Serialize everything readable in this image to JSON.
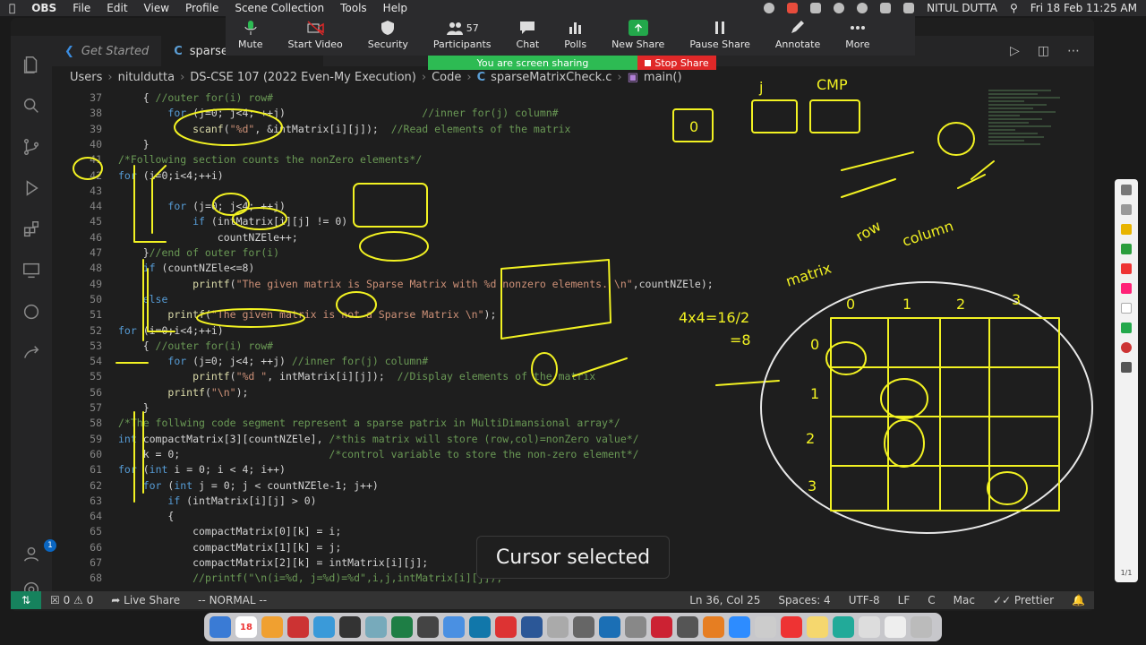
{
  "menubar": {
    "app": "OBS",
    "items": [
      "File",
      "Edit",
      "View",
      "Profile",
      "Scene Collection",
      "Tools",
      "Help"
    ],
    "user": "NITUL DUTTA",
    "datetime": "Fri 18 Feb  11:25 AM"
  },
  "zoom": {
    "buttons": [
      {
        "label": "Mute",
        "icon": "microphone-icon"
      },
      {
        "label": "Start Video",
        "icon": "video-off-icon"
      },
      {
        "label": "Security",
        "icon": "shield-icon"
      },
      {
        "label": "Participants",
        "icon": "participants-icon",
        "count": "57"
      },
      {
        "label": "Chat",
        "icon": "chat-icon"
      },
      {
        "label": "Polls",
        "icon": "polls-icon"
      },
      {
        "label": "New Share",
        "icon": "share-icon"
      },
      {
        "label": "Pause Share",
        "icon": "pause-icon"
      },
      {
        "label": "Annotate",
        "icon": "pencil-icon"
      },
      {
        "label": "More",
        "icon": "more-icon"
      }
    ],
    "sharing_msg": "You are screen sharing",
    "stop_share": "Stop Share"
  },
  "tabs": [
    {
      "label": "Get Started"
    },
    {
      "label": "sparseMatrixCheck.c"
    }
  ],
  "breadcrumb": [
    "Users",
    "nituldutta",
    "DS-CSE 107 (2022 Even-My Execution)",
    "Code",
    "sparseMatrixCheck.c",
    "main()"
  ],
  "code_lines": [
    {
      "n": "37",
      "text": "    { //outer for(i) row#"
    },
    {
      "n": "38",
      "text": "        for (j=0; j<4; ++j)                      //inner for(j) column#"
    },
    {
      "n": "39",
      "text": "            scanf(\"%d\", &intMatrix[i][j]);  //Read elements of the matrix"
    },
    {
      "n": "40",
      "text": "    }"
    },
    {
      "n": "41",
      "text": "/*Following section counts the nonZero elements*/"
    },
    {
      "n": "42",
      "text": "for (i=0;i<4;++i)"
    },
    {
      "n": "43",
      "text": ""
    },
    {
      "n": "44",
      "text": "        for (j=0; j<4; ++j)"
    },
    {
      "n": "45",
      "text": "            if (intMatrix[i][j] != 0)"
    },
    {
      "n": "46",
      "text": "                countNZEle++;"
    },
    {
      "n": "47",
      "text": "    }//end of outer for(i)"
    },
    {
      "n": "48",
      "text": "    if (countNZEle<=8)"
    },
    {
      "n": "49",
      "text": "            printf(\"The given matrix is Sparse Matrix with %d nonzero elements. \\n\",countNZEle);"
    },
    {
      "n": "50",
      "text": "    else"
    },
    {
      "n": "51",
      "text": "        printf(\"The given matrix is not a Sparse Matrix \\n\");"
    },
    {
      "n": "52",
      "text": "for (i=0;i<4;++i)"
    },
    {
      "n": "53",
      "text": "    { //outer for(i) row#"
    },
    {
      "n": "54",
      "text": "        for (j=0; j<4; ++j) //inner for(j) column#"
    },
    {
      "n": "55",
      "text": "            printf(\"%d \", intMatrix[i][j]);  //Display elements of the matrix"
    },
    {
      "n": "56",
      "text": "        printf(\"\\n\");"
    },
    {
      "n": "57",
      "text": "    }"
    },
    {
      "n": "58",
      "text": "/*The follwing code segment represent a sparse patrix in MultiDimansional array*/"
    },
    {
      "n": "59",
      "text": "int compactMatrix[3][countNZEle], /*this matrix will store (row,col)=nonZero value*/"
    },
    {
      "n": "60",
      "text": "    k = 0;                        /*control variable to store the non-zero element*/"
    },
    {
      "n": "61",
      "text": "for (int i = 0; i < 4; i++)"
    },
    {
      "n": "62",
      "text": "    for (int j = 0; j < countNZEle-1; j++)"
    },
    {
      "n": "63",
      "text": "        if (intMatrix[i][j] > 0)"
    },
    {
      "n": "64",
      "text": "        {"
    },
    {
      "n": "65",
      "text": "            compactMatrix[0][k] = i;"
    },
    {
      "n": "66",
      "text": "            compactMatrix[1][k] = j;"
    },
    {
      "n": "67",
      "text": "            compactMatrix[2][k] = intMatrix[i][j];"
    },
    {
      "n": "68",
      "text": "            //printf(\"\\n(i=%d, j=%d)=%d\",i,j,intMatrix[i][j]);"
    }
  ],
  "toast": "Cursor selected",
  "status": {
    "errors": "0",
    "warnings": "0",
    "live_share": "Live Share",
    "mode": "-- NORMAL --",
    "position": "Ln 36, Col 25",
    "spaces": "Spaces: 4",
    "encoding": "UTF-8",
    "eol": "LF",
    "language": "C",
    "os": "Mac",
    "formatter": "Prettier"
  },
  "accounts_badge": "1",
  "annotation_page": "1/1",
  "ink_labels": {
    "cmp": "CMP",
    "j": "j",
    "row": "row",
    "column": "column",
    "matrix": "matrix",
    "col_0": "0",
    "col_1": "1",
    "col_2": "2",
    "col_3": "3",
    "row_0": "0",
    "row_1": "1",
    "row_2": "2",
    "row_3": "3",
    "calc": "4x4=16/2",
    "eight": "=8"
  },
  "dock_date": "18"
}
